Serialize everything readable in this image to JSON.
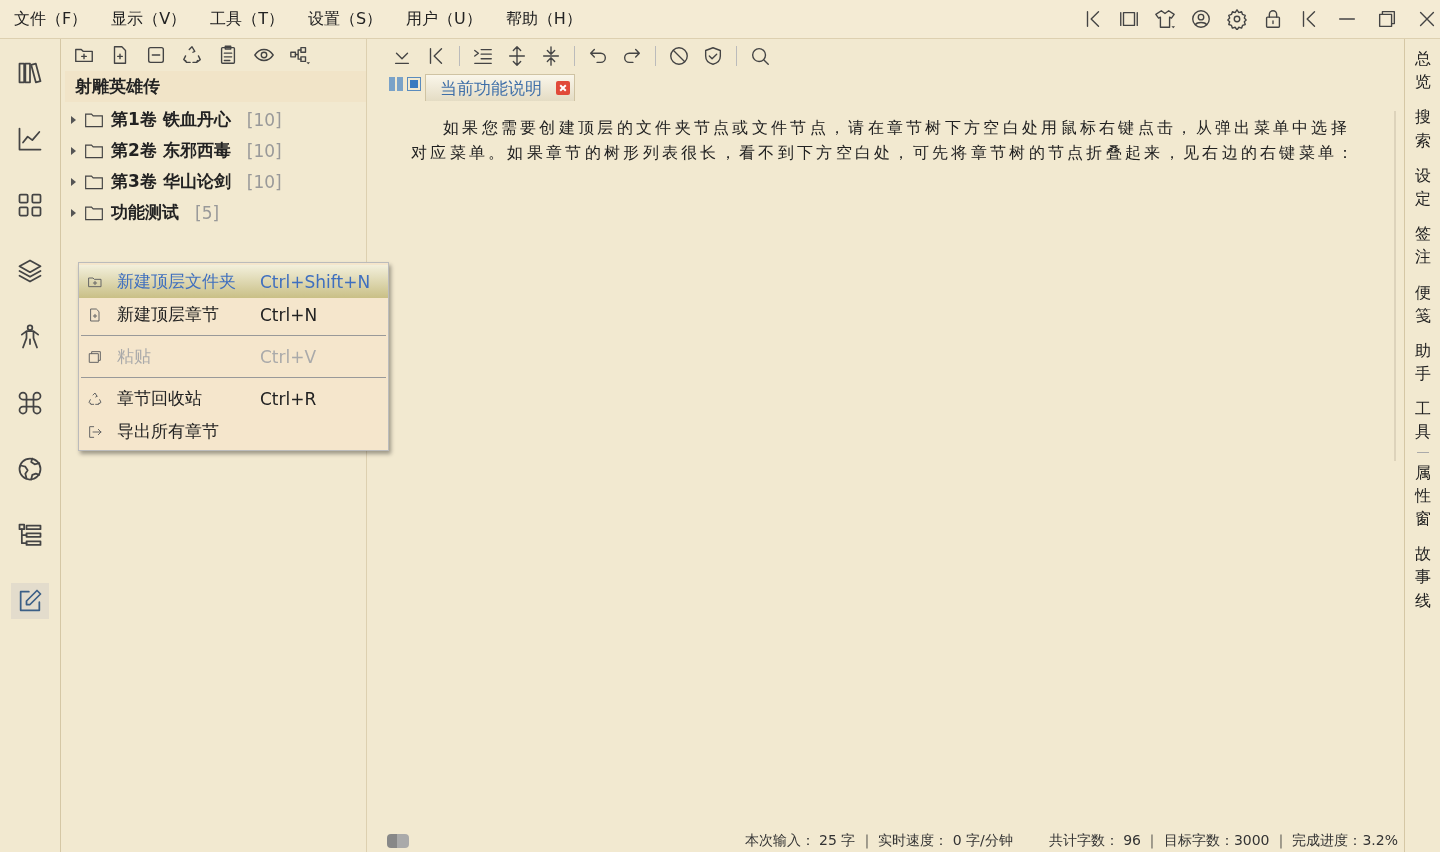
{
  "menu": [
    {
      "label": "文件（F）"
    },
    {
      "label": "显示（V）"
    },
    {
      "label": "工具（T）"
    },
    {
      "label": "设置（S）"
    },
    {
      "label": "用户（U）"
    },
    {
      "label": "帮助（H）"
    }
  ],
  "left_rail": [
    {
      "kind": "books",
      "selected": false
    },
    {
      "kind": "chart",
      "selected": false
    },
    {
      "kind": "grid",
      "selected": false
    },
    {
      "kind": "layers",
      "selected": false
    },
    {
      "kind": "person",
      "selected": false
    },
    {
      "kind": "command",
      "selected": false
    },
    {
      "kind": "globe",
      "selected": false
    },
    {
      "kind": "tree",
      "selected": false
    },
    {
      "kind": "edit",
      "selected": true
    }
  ],
  "tree": {
    "title": "射雕英雄传",
    "nodes": [
      {
        "label": "第1卷 铁血丹心",
        "count": "[10]",
        "expanded": false
      },
      {
        "label": "第2卷 东邪西毒",
        "count": "[10]",
        "expanded": false
      },
      {
        "label": "第3卷 华山论剑",
        "count": "[10]",
        "expanded": false
      },
      {
        "label": "功能测试",
        "count": "[5]",
        "expanded": false
      }
    ]
  },
  "tab": {
    "label": "当前功能说明"
  },
  "paragraph": "如果您需要创建顶层的文件夹节点或文件节点，请在章节树下方空白处用鼠标右键点击，从弹出菜单中选择对应菜单。如果章节的树形列表很长，看不到下方空白处，可先将章节树的节点折叠起来，见右边的右键菜单：",
  "context_menu": [
    {
      "kind": "item",
      "label": "新建顶层文件夹",
      "shortcut": "Ctrl+Shift+N",
      "selected": true,
      "disabled": false
    },
    {
      "kind": "item",
      "label": "新建顶层章节",
      "shortcut": "Ctrl+N",
      "selected": false,
      "disabled": false
    },
    {
      "kind": "separator"
    },
    {
      "kind": "item",
      "label": "粘贴",
      "shortcut": "Ctrl+V",
      "selected": false,
      "disabled": true
    },
    {
      "kind": "separator"
    },
    {
      "kind": "item",
      "label": "章节回收站",
      "shortcut": "Ctrl+R",
      "selected": false,
      "disabled": false
    },
    {
      "kind": "item",
      "label": "导出所有章节",
      "selected": false,
      "disabled": false
    }
  ],
  "right_rail": [
    {
      "kind": "tab",
      "label": "总览"
    },
    {
      "kind": "tab",
      "label": "搜索"
    },
    {
      "kind": "tab",
      "label": "设定"
    },
    {
      "kind": "tab",
      "label": "签注"
    },
    {
      "kind": "tab",
      "label": "便笺"
    },
    {
      "kind": "tab",
      "label": "助手"
    },
    {
      "kind": "tab",
      "label": "工具"
    },
    {
      "kind": "separator"
    },
    {
      "kind": "tab",
      "label": "属性窗"
    },
    {
      "kind": "tab",
      "label": "故事线"
    }
  ],
  "status_bar": [
    "本次输入： 25 字 ｜ 实时速度： 0 字/分钟",
    "共计字数： 96 ｜ 目标字数：3000 ｜ 完成进度：3.2%"
  ]
}
